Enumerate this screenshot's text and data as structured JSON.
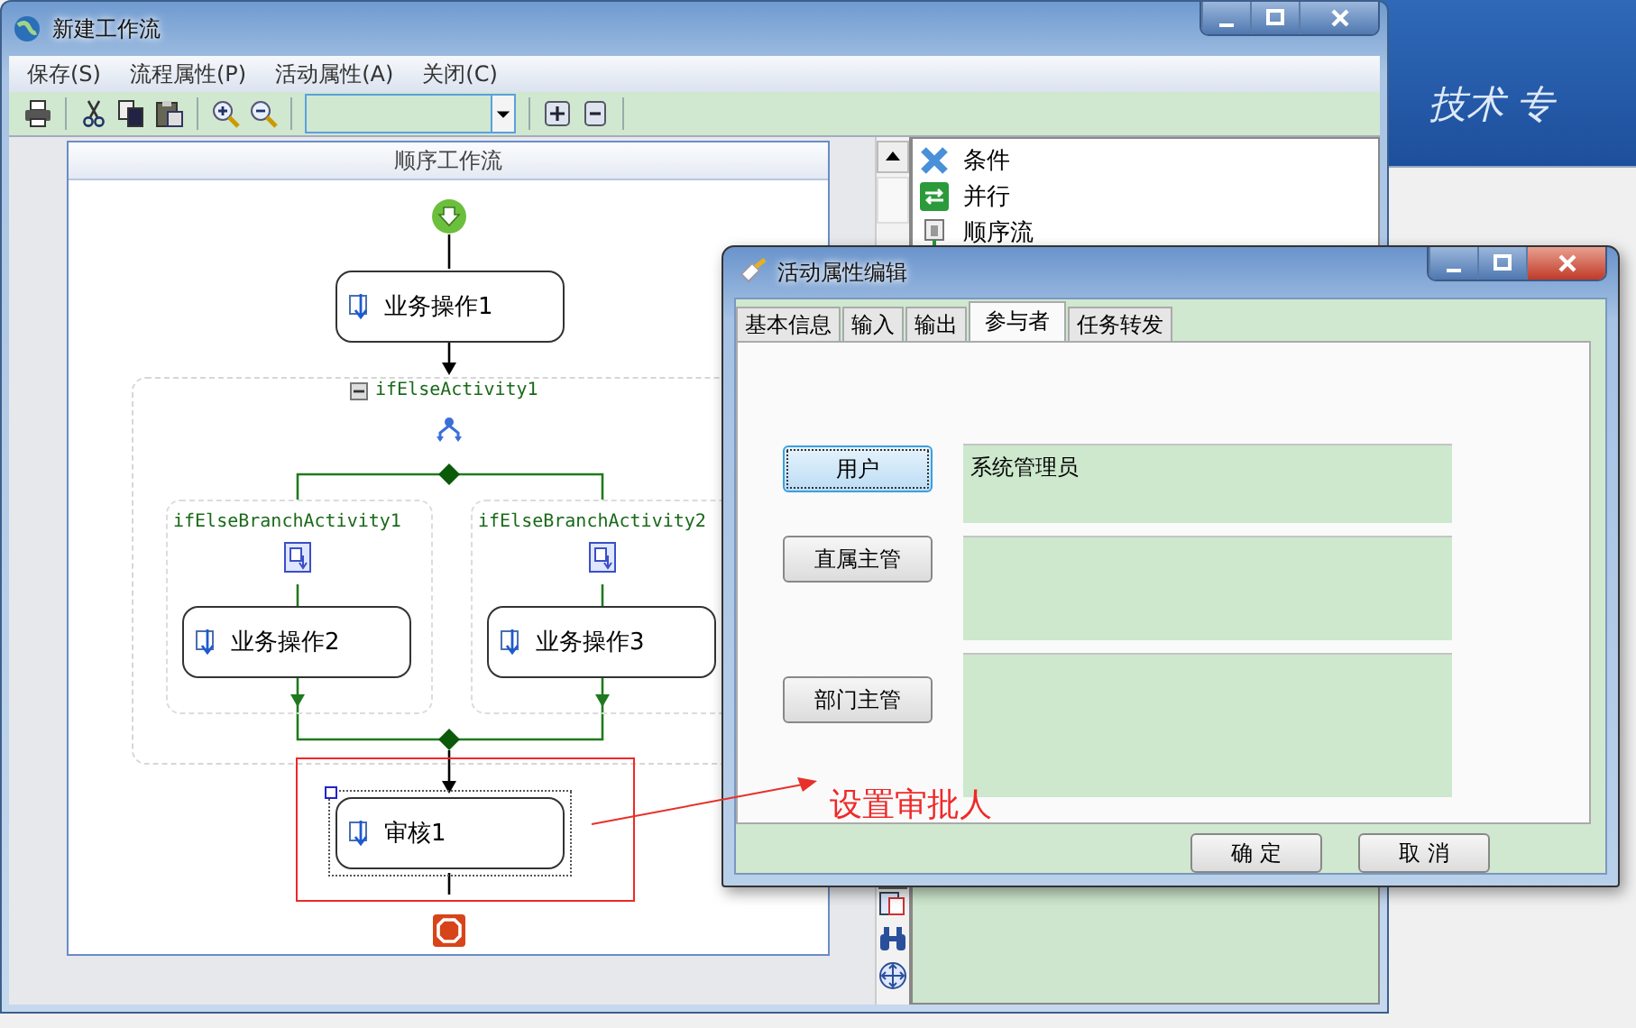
{
  "background_text": "技术 专",
  "main_window": {
    "title": "新建工作流",
    "menu": [
      "保存(S)",
      "流程属性(P)",
      "活动属性(A)",
      "关闭(C)"
    ],
    "canvas_title": "顺序工作流",
    "diagram": {
      "first_step": "业务操作1",
      "if_else": {
        "label": "ifElseActivity1",
        "expanded": true,
        "branches": [
          {
            "label": "ifElseBranchActivity1",
            "step": "业务操作2"
          },
          {
            "label": "ifElseBranchActivity2",
            "step": "业务操作3"
          }
        ]
      },
      "last_step": {
        "label": "审核1",
        "selected": true
      }
    },
    "toolbox": [
      {
        "label": "条件",
        "kind": "condition"
      },
      {
        "label": "并行",
        "kind": "parallel"
      },
      {
        "label": "顺序流",
        "kind": "sequence"
      }
    ]
  },
  "dialog": {
    "title": "活动属性编辑",
    "tabs": [
      {
        "label": "基本信息",
        "selected": false
      },
      {
        "label": "输入",
        "selected": false
      },
      {
        "label": "输出",
        "selected": false
      },
      {
        "label": "参与者",
        "selected": true
      },
      {
        "label": "任务转发",
        "selected": false
      }
    ],
    "participants": [
      {
        "button": "用户",
        "value": "系统管理员",
        "focused": true
      },
      {
        "button": "直属主管",
        "focused": false
      },
      {
        "button": "部门主管",
        "focused": false
      }
    ],
    "buttons": [
      "确 定",
      "取 消"
    ]
  },
  "annotation": {
    "text": "设置审批人"
  }
}
